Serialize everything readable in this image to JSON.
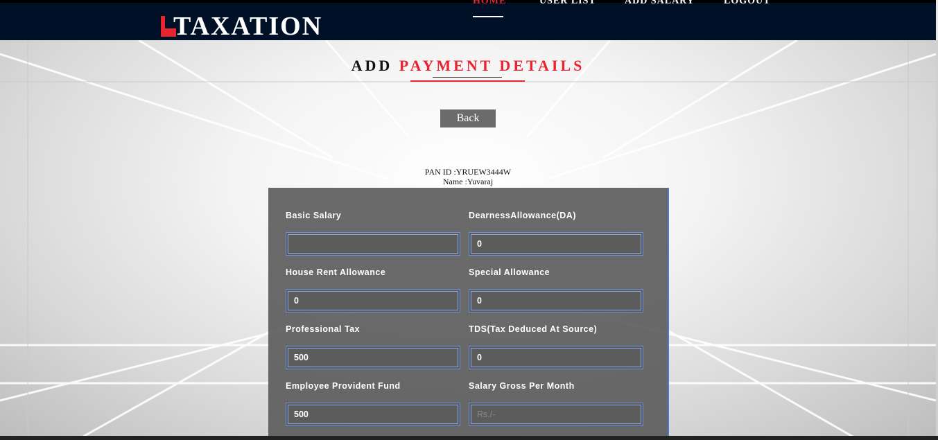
{
  "brand": {
    "name": "TAXATION",
    "accent": "#e8242f",
    "navbar_bg": "#001127"
  },
  "nav": {
    "items": [
      {
        "label": "HOME",
        "active": true
      },
      {
        "label": "USER LIST",
        "active": false
      },
      {
        "label": "ADD SALARY",
        "active": false
      },
      {
        "label": "LOGOUT",
        "active": false
      }
    ]
  },
  "page": {
    "title_prefix": "ADD",
    "title_highlight": "PAYMENT DETAILS",
    "back_label": "Back",
    "pan_line": "PAN ID :YRUEW3444W",
    "name_line": "Name :Yuvaraj"
  },
  "form": {
    "basic_salary": {
      "label": "Basic Salary",
      "value": ""
    },
    "da": {
      "label": "DearnessAllowance(DA)",
      "value": "0"
    },
    "hra": {
      "label": "House Rent Allowance",
      "value": "0"
    },
    "special": {
      "label": "Special Allowance",
      "value": "0"
    },
    "prof_tax": {
      "label": "Professional Tax",
      "value": "500"
    },
    "tds": {
      "label": "TDS(Tax Deduced At Source)",
      "value": "0"
    },
    "epf": {
      "label": "Employee Provident Fund",
      "value": "500"
    },
    "gross": {
      "label": "Salary Gross Per Month",
      "value": "",
      "placeholder": "Rs./-"
    }
  }
}
